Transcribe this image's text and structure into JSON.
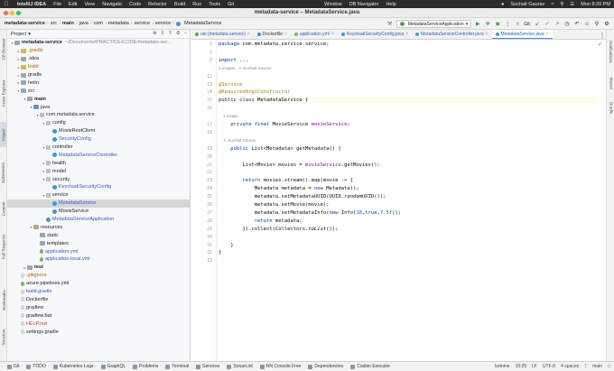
{
  "menubar": {
    "app": "IntelliJ IDEA",
    "items": [
      "File",
      "Edit",
      "View",
      "Navigate",
      "Code",
      "Refactor",
      "Build",
      "Run",
      "Tools",
      "Git",
      "Window",
      "DB Navigator",
      "Help"
    ],
    "user": "Suchait Gaurav",
    "clock": "Mon 8:20 PM"
  },
  "window": {
    "title": "metadata-service – MetadataService.java"
  },
  "breadcrumb": [
    "metadata-service",
    "src",
    "main",
    "java",
    "com",
    "metadata",
    "service",
    "service",
    "MetadataService"
  ],
  "toolbar": {
    "run_config": "MetadataServiceApplication",
    "git_label": "Git:"
  },
  "left_strip": [
    "DB Browser",
    "Azure Explorer",
    "Project",
    "Kubernetes",
    "Commit",
    "Pull Requests",
    "Bookmarks",
    "Structure"
  ],
  "right_strip": [
    "Notifications",
    "Maven",
    "Gradle"
  ],
  "project": {
    "header": "Project",
    "tree": [
      {
        "label": "metadata-service",
        "suffix": "~/Documents/PRACTICE/CODE/metadata-ser...",
        "depth": 0,
        "arrow": "open",
        "icon": "folder",
        "style": "bold"
      },
      {
        "label": ".gradle",
        "depth": 1,
        "arrow": "closed",
        "icon": "folder yellow",
        "style": "orange"
      },
      {
        "label": ".idea",
        "depth": 1,
        "arrow": "closed",
        "icon": "folder",
        "style": ""
      },
      {
        "label": "build",
        "depth": 1,
        "arrow": "closed",
        "icon": "folder yellow",
        "style": "orange"
      },
      {
        "label": "gradle",
        "depth": 1,
        "arrow": "closed",
        "icon": "folder",
        "style": ""
      },
      {
        "label": "helm",
        "depth": 1,
        "arrow": "closed",
        "icon": "folder",
        "style": ""
      },
      {
        "label": "src",
        "depth": 1,
        "arrow": "open",
        "icon": "folder",
        "style": ""
      },
      {
        "label": "main",
        "depth": 2,
        "arrow": "open",
        "icon": "folder",
        "style": "bold"
      },
      {
        "label": "java",
        "depth": 3,
        "arrow": "open",
        "icon": "folder src",
        "style": ""
      },
      {
        "label": "com.metadata.service",
        "depth": 4,
        "arrow": "open",
        "icon": "pkg",
        "style": ""
      },
      {
        "label": "config",
        "depth": 5,
        "arrow": "open",
        "icon": "pkg",
        "style": ""
      },
      {
        "label": "MovieRestClient",
        "depth": 6,
        "arrow": "",
        "icon": "cls",
        "style": ""
      },
      {
        "label": "SecurityConfig",
        "depth": 6,
        "arrow": "",
        "icon": "cls",
        "style": "blue"
      },
      {
        "label": "controller",
        "depth": 5,
        "arrow": "open",
        "icon": "pkg",
        "style": ""
      },
      {
        "label": "MetadataServiceController",
        "depth": 6,
        "arrow": "",
        "icon": "cls",
        "style": "blue"
      },
      {
        "label": "health",
        "depth": 5,
        "arrow": "closed",
        "icon": "pkg",
        "style": ""
      },
      {
        "label": "model",
        "depth": 5,
        "arrow": "closed",
        "icon": "pkg",
        "style": ""
      },
      {
        "label": "security",
        "depth": 5,
        "arrow": "open",
        "icon": "pkg",
        "style": ""
      },
      {
        "label": "KeycloakSecurityConfig",
        "depth": 6,
        "arrow": "",
        "icon": "cls",
        "style": "blue"
      },
      {
        "label": "service",
        "depth": 5,
        "arrow": "open",
        "icon": "pkg",
        "style": ""
      },
      {
        "label": "MetadataService",
        "depth": 6,
        "arrow": "",
        "icon": "cls",
        "style": "blue",
        "selected": true
      },
      {
        "label": "MovieService",
        "depth": 6,
        "arrow": "",
        "icon": "cls",
        "style": ""
      },
      {
        "label": "MetadataServiceApplication",
        "depth": 5,
        "arrow": "",
        "icon": "cls",
        "style": "blue"
      },
      {
        "label": "resources",
        "depth": 3,
        "arrow": "open",
        "icon": "folder res",
        "style": ""
      },
      {
        "label": "static",
        "depth": 4,
        "arrow": "",
        "icon": "folder",
        "style": ""
      },
      {
        "label": "templates",
        "depth": 4,
        "arrow": "",
        "icon": "folder",
        "style": ""
      },
      {
        "label": "application.yml",
        "depth": 4,
        "arrow": "",
        "icon": "yml",
        "style": "blue"
      },
      {
        "label": "application-local.yml",
        "depth": 4,
        "arrow": "",
        "icon": "yml",
        "style": "blue"
      },
      {
        "label": "test",
        "depth": 2,
        "arrow": "closed",
        "icon": "folder",
        "style": "bold"
      },
      {
        "label": ".gitignore",
        "depth": 1,
        "arrow": "",
        "icon": "file",
        "style": "orange"
      },
      {
        "label": "azure-pipelines.yml",
        "depth": 1,
        "arrow": "",
        "icon": "yml",
        "style": ""
      },
      {
        "label": "build.gradle",
        "depth": 1,
        "arrow": "",
        "icon": "file",
        "style": "blue"
      },
      {
        "label": "Dockerfile",
        "depth": 1,
        "arrow": "",
        "icon": "file",
        "style": ""
      },
      {
        "label": "gradlew",
        "depth": 1,
        "arrow": "",
        "icon": "file",
        "style": ""
      },
      {
        "label": "gradlew.bat",
        "depth": 1,
        "arrow": "",
        "icon": "file",
        "style": ""
      },
      {
        "label": "HELP.md",
        "depth": 1,
        "arrow": "",
        "icon": "file",
        "style": "red"
      },
      {
        "label": "settings.gradle",
        "depth": 1,
        "arrow": "",
        "icon": "file",
        "style": ""
      }
    ]
  },
  "tabs": [
    {
      "label": "ule (metadata-service)",
      "dot": "#5aa05a",
      "active": false,
      "blue": true
    },
    {
      "label": "Dockerfile",
      "dot": "#4a86e8",
      "active": false,
      "blue": false
    },
    {
      "label": "application.yml",
      "dot": "#7bb36a",
      "active": false,
      "blue": true
    },
    {
      "label": "KeycloakSecurityConfig.java",
      "dot": "#3c9ad9",
      "active": false,
      "blue": true
    },
    {
      "label": "MetadataServiceController.java",
      "dot": "#3c9ad9",
      "active": false,
      "blue": true
    },
    {
      "label": "MetadataService.java",
      "dot": "#3c9ad9",
      "active": true,
      "blue": true
    }
  ],
  "editor": {
    "lines": [
      {
        "n": "1",
        "html": "<span class='kw'>package</span> com.metadata.service.service;"
      },
      {
        "n": "2",
        "html": ""
      },
      {
        "n": "3",
        "html": "<span class='kw'>import</span> ..."
      },
      {
        "n": "12",
        "html": "",
        "hint": "3 usages   ♙ Suchait Gaurav"
      },
      {
        "n": "13",
        "html": "<span class='an'>@Service</span>"
      },
      {
        "n": "14",
        "html": "<span class='an'>@RequiredArgsConstructor</span>"
      },
      {
        "n": "15",
        "html": "<span class='kw'>public class</span> MetadataService {",
        "current": true
      },
      {
        "n": "16",
        "html": ""
      },
      {
        "n": "17",
        "html": "    <span class='kw'>private final</span> MovieService <span class='fld'>movieService</span>;",
        "hint": "    1 usage"
      },
      {
        "n": "18",
        "html": ""
      },
      {
        "n": "19",
        "html": "    <span class='kw'>public</span> List&lt;Metadata&gt; getMetadata() {",
        "hint": "    ♙ Suchait Gaurav"
      },
      {
        "n": "20",
        "html": ""
      },
      {
        "n": "21",
        "html": "        List&lt;Movie&gt; movies = <span class='fld'>movieService</span>.getMovies();"
      },
      {
        "n": "22",
        "html": ""
      },
      {
        "n": "23",
        "html": "        <span class='kw'>return</span> movies.stream().map(movie -&gt; {"
      },
      {
        "n": "24",
        "html": "            Metadata metadata = <span class='kw'>new</span> Metadata();"
      },
      {
        "n": "25",
        "html": "            metadata.setMetadataUUID(UUID.<i>randomUUID</i>());"
      },
      {
        "n": "26",
        "html": "            metadata.setMovie(movie);"
      },
      {
        "n": "27",
        "html": "            metadata.setMetadataInfo(<span class='kw'>new</span> Info(<span class='num'>10</span>,<span class='kw'>true</span>,<span class='num'>7.5f</span>));"
      },
      {
        "n": "28",
        "html": "            <span class='kw'>return</span> metadata;"
      },
      {
        "n": "29",
        "html": "        }).collect(Collectors.<i>toList</i>());"
      },
      {
        "n": "30",
        "html": ""
      },
      {
        "n": "31",
        "html": "    }"
      },
      {
        "n": "32",
        "html": "}"
      },
      {
        "n": "33",
        "html": ""
      }
    ]
  },
  "bottombar": {
    "tools": [
      "Git",
      "TODO",
      "Kubernetes Logs",
      "GraphQL",
      "Problems",
      "Terminal",
      "Services",
      "SonarLint",
      "RN Console Free",
      "Dependencies",
      "Casbin Executor"
    ],
    "status": {
      "notice": "botnine",
      "position": "15:25",
      "line_sep": "LF",
      "encoding": "UTF-8",
      "indent": "4 spaces",
      "branch": "main"
    }
  },
  "colors": {
    "accent": "#4a86e8",
    "selected_row": "#d5d5d5",
    "annotation": "#9e880d",
    "keyword": "#0033b3"
  }
}
